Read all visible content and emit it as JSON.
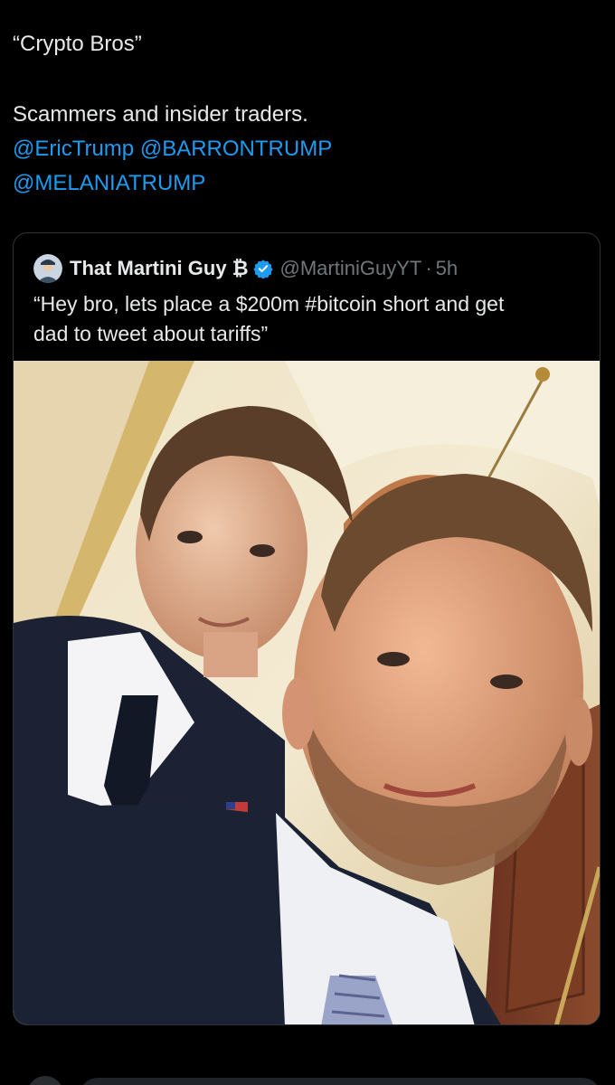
{
  "tweet": {
    "lines": [
      "“Crypto Bros”",
      "Scammers and insider traders."
    ],
    "mentions": [
      "@EricTrump",
      "@BARRONTRUMP",
      "@MELANIATRUMP"
    ]
  },
  "quote": {
    "author_name": "That Martini Guy",
    "name_symbol": "₿",
    "handle": "@MartiniGuyYT",
    "separator": "·",
    "time": "5h",
    "text_lines": [
      "“Hey bro, lets place a $200m #bitcoin short and get",
      "dad to tweet about tariffs”"
    ]
  },
  "colors": {
    "background": "#000000",
    "text": "#e7e9ea",
    "link": "#1d9bf0",
    "muted": "#71767b",
    "border": "#2f3336",
    "verified": "#1d9bf0"
  },
  "icons": {
    "verified": "verified-badge-icon",
    "avatar": "profile-avatar"
  }
}
